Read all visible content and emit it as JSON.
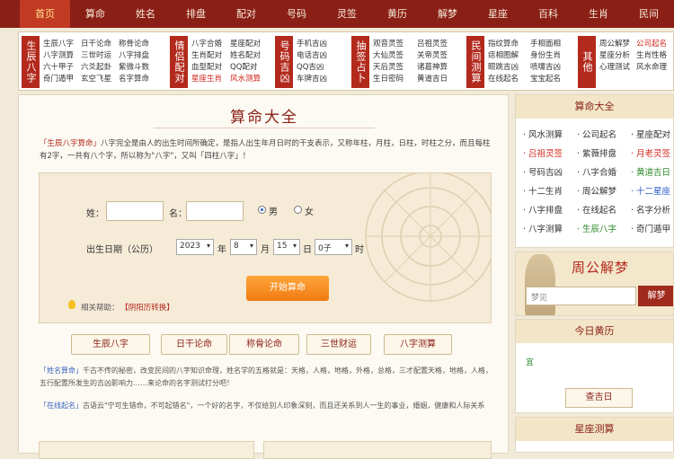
{
  "nav": [
    "首页",
    "算命",
    "姓名",
    "排盘",
    "配对",
    "号码",
    "灵签",
    "黄历",
    "解梦",
    "星座",
    "百科",
    "生肖",
    "民间"
  ],
  "categories": [
    {
      "label": "生辰八字",
      "links": [
        "生辰八字",
        "日干论命",
        "称骨论命",
        "八字测算",
        "三世时运",
        "八字排盘",
        "六十甲子",
        "六爻起卦",
        "紫微斗数",
        "奇门遁甲",
        "玄空飞星",
        "名字算命"
      ],
      "red": []
    },
    {
      "label": "情侣配对",
      "links": [
        "八字合婚",
        "星座配对",
        "生肖配对",
        "姓名配对",
        "血型配对",
        "QQ配对",
        "星座生肖",
        "风水测算"
      ],
      "red": [
        6,
        7
      ]
    },
    {
      "label": "号码吉凶",
      "links": [
        "手机吉凶",
        "电话吉凶",
        "QQ吉凶",
        "车牌吉凶"
      ],
      "red": []
    },
    {
      "label": "抽签占卜",
      "links": [
        "观音灵签",
        "吕祖灵签",
        "大仙灵签",
        "关帝灵签",
        "天后灵签",
        "诸葛神算",
        "生日密码",
        "黄道吉日"
      ],
      "red": []
    },
    {
      "label": "民间测算",
      "links": [
        "指纹算命",
        "手相面相",
        "痣相图解",
        "身份生肖",
        "眼跳吉凶",
        "喷嚏吉凶",
        "在线起名",
        "宝宝起名"
      ],
      "red": []
    },
    {
      "label": "其他",
      "links": [
        "周公解梦",
        "公司起名",
        "星座分析",
        "生肖性格",
        "心理测试",
        "风水命理"
      ],
      "red": [
        1
      ]
    }
  ],
  "main": {
    "title": "算命大全",
    "intro_lead": "「生辰八字算命」",
    "intro": "八字完全是由人的出生时间所确定，是指人出生年月日时的干支表示，又称年柱，月柱，日柱，时柱之分，而且每柱有2字，一共有八个字，所以称为\"八字\"，又叫「四柱八字」！",
    "form": {
      "surname_label": "姓：",
      "name_label": "名：",
      "male": "男",
      "female": "女",
      "birth_label": "出生日期（公历）",
      "year": "2023",
      "year_unit": "年",
      "month": "8",
      "month_unit": "月",
      "day": "15",
      "day_unit": "日",
      "hour": "0子",
      "hour_unit": "时",
      "submit": "开始算命",
      "help_label": "相关帮助：",
      "help_link": "【阴阳历转换】"
    },
    "sub_buttons": [
      "生辰八字",
      "日干论命",
      "称骨论命",
      "三世财运",
      "八字测算"
    ],
    "para1_lead": "「姓名算命」",
    "para1": "千古不传的秘密，改变民间的八字知识命理，姓名学的五格就是：天格，人格，地格，外格，总格，三才配置天格，地格，人格，五行配置所发生的吉凶影响力……来论命的名字测试打分吧！",
    "para2_lead": "「在线起名」",
    "para2": "古语云\"宁可生错命，不可起错名\"，一个好的名字，不仅给别人印象深刻，而且还关系到人一生的事业，婚姻，健康和人际关系"
  },
  "sidebar": {
    "title": "算命大全",
    "links": [
      {
        "t": "风水测算",
        "c": ""
      },
      {
        "t": "公司起名",
        "c": ""
      },
      {
        "t": "星座配对",
        "c": ""
      },
      {
        "t": "吕祖灵签",
        "c": "red"
      },
      {
        "t": "紫薇排盘",
        "c": ""
      },
      {
        "t": "月老灵签",
        "c": "red"
      },
      {
        "t": "号码吉凶",
        "c": ""
      },
      {
        "t": "八字合婚",
        "c": ""
      },
      {
        "t": "黄道吉日",
        "c": "green"
      },
      {
        "t": "十二生肖",
        "c": ""
      },
      {
        "t": "周公解梦",
        "c": ""
      },
      {
        "t": "十二星座",
        "c": "blue"
      },
      {
        "t": "八字排盘",
        "c": ""
      },
      {
        "t": "在线起名",
        "c": ""
      },
      {
        "t": "名字分析",
        "c": ""
      },
      {
        "t": "八字测算",
        "c": ""
      },
      {
        "t": "生辰八字",
        "c": "green"
      },
      {
        "t": "奇门遁甲",
        "c": ""
      }
    ],
    "zhougong_title": "周公解梦",
    "dream_placeholder": "梦见",
    "dream_btn": "解梦",
    "almanac_title": "今日黄历",
    "almanac_mark": "宜",
    "almanac_btn": "查吉日",
    "zodiac_title": "星座测算"
  },
  "colors": {
    "nav_bg": "#8a1f16",
    "accent": "#b32a1d",
    "button": "#f07a12"
  }
}
